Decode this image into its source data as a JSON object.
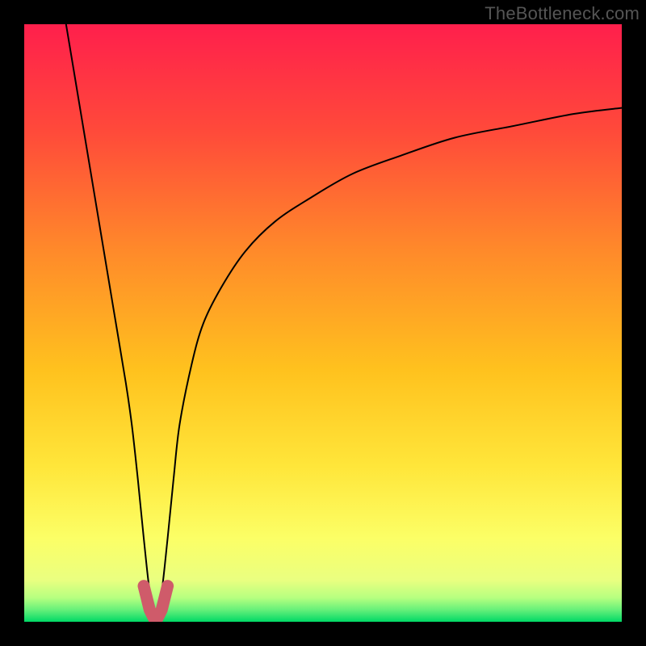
{
  "watermark": "TheBottleneck.com",
  "chart_data": {
    "type": "line",
    "title": "",
    "xlabel": "",
    "ylabel": "",
    "xlim": [
      0,
      100
    ],
    "ylim": [
      0,
      100
    ],
    "grid": false,
    "colors": {
      "top": "#ff1f4c",
      "mid": "#ffd400",
      "bottom": "#00d966",
      "curve": "#000000",
      "marker": "#cf5b6a"
    },
    "minimum_x": 22,
    "series": [
      {
        "name": "curve",
        "x": [
          7,
          9,
          11,
          13,
          15,
          17,
          18,
          19,
          20,
          21,
          22,
          23,
          24,
          25,
          26,
          28,
          30,
          33,
          37,
          42,
          48,
          55,
          63,
          72,
          82,
          92,
          100
        ],
        "y": [
          100,
          88,
          76,
          64,
          52,
          40,
          33,
          24,
          14,
          5,
          0,
          5,
          14,
          24,
          33,
          43,
          50,
          56,
          62,
          67,
          71,
          75,
          78,
          81,
          83,
          85,
          86
        ]
      },
      {
        "name": "marker",
        "x": [
          20,
          21,
          22,
          23,
          24
        ],
        "y": [
          6,
          2,
          0,
          2,
          6
        ]
      }
    ]
  }
}
